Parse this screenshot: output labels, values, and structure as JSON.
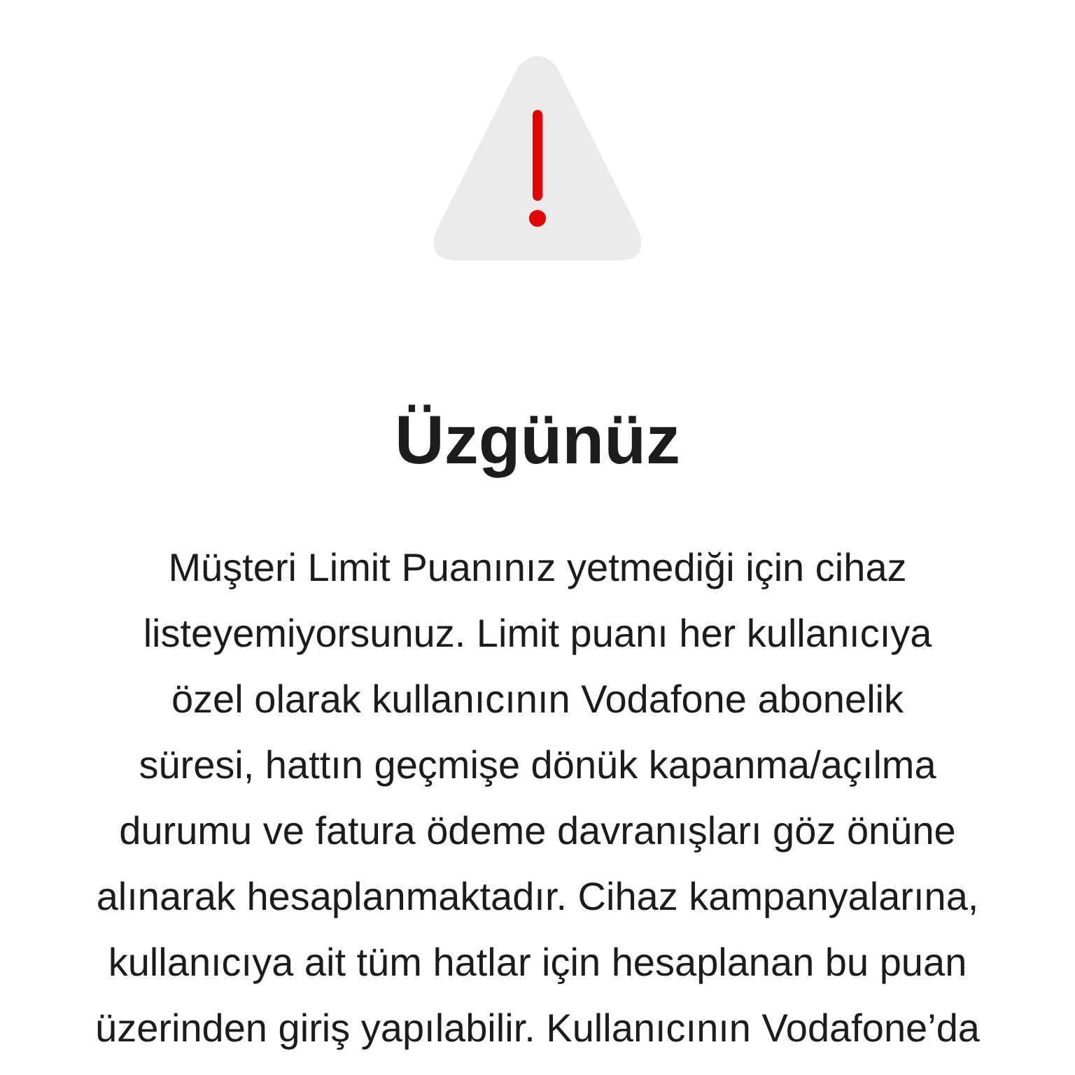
{
  "title": "Üzgünüz",
  "message": "Müşteri Limit Puanınız yetmediği için cihaz\nlisteyemiyorsunuz. Limit puanı her kullanıcıya\nözel olarak kullanıcının Vodafone abonelik\nsüresi, hattın geçmişe dönük kapanma/açılma\ndurumu ve fatura ödeme davranışları göz önüne\nalınarak hesaplanmaktadır. Cihaz kampanyalarına,\nkullanıcıya ait tüm hatlar için hesaplanan bu puan\nüzerinden giriş yapılabilir. Kullanıcının Vodafone’da"
}
